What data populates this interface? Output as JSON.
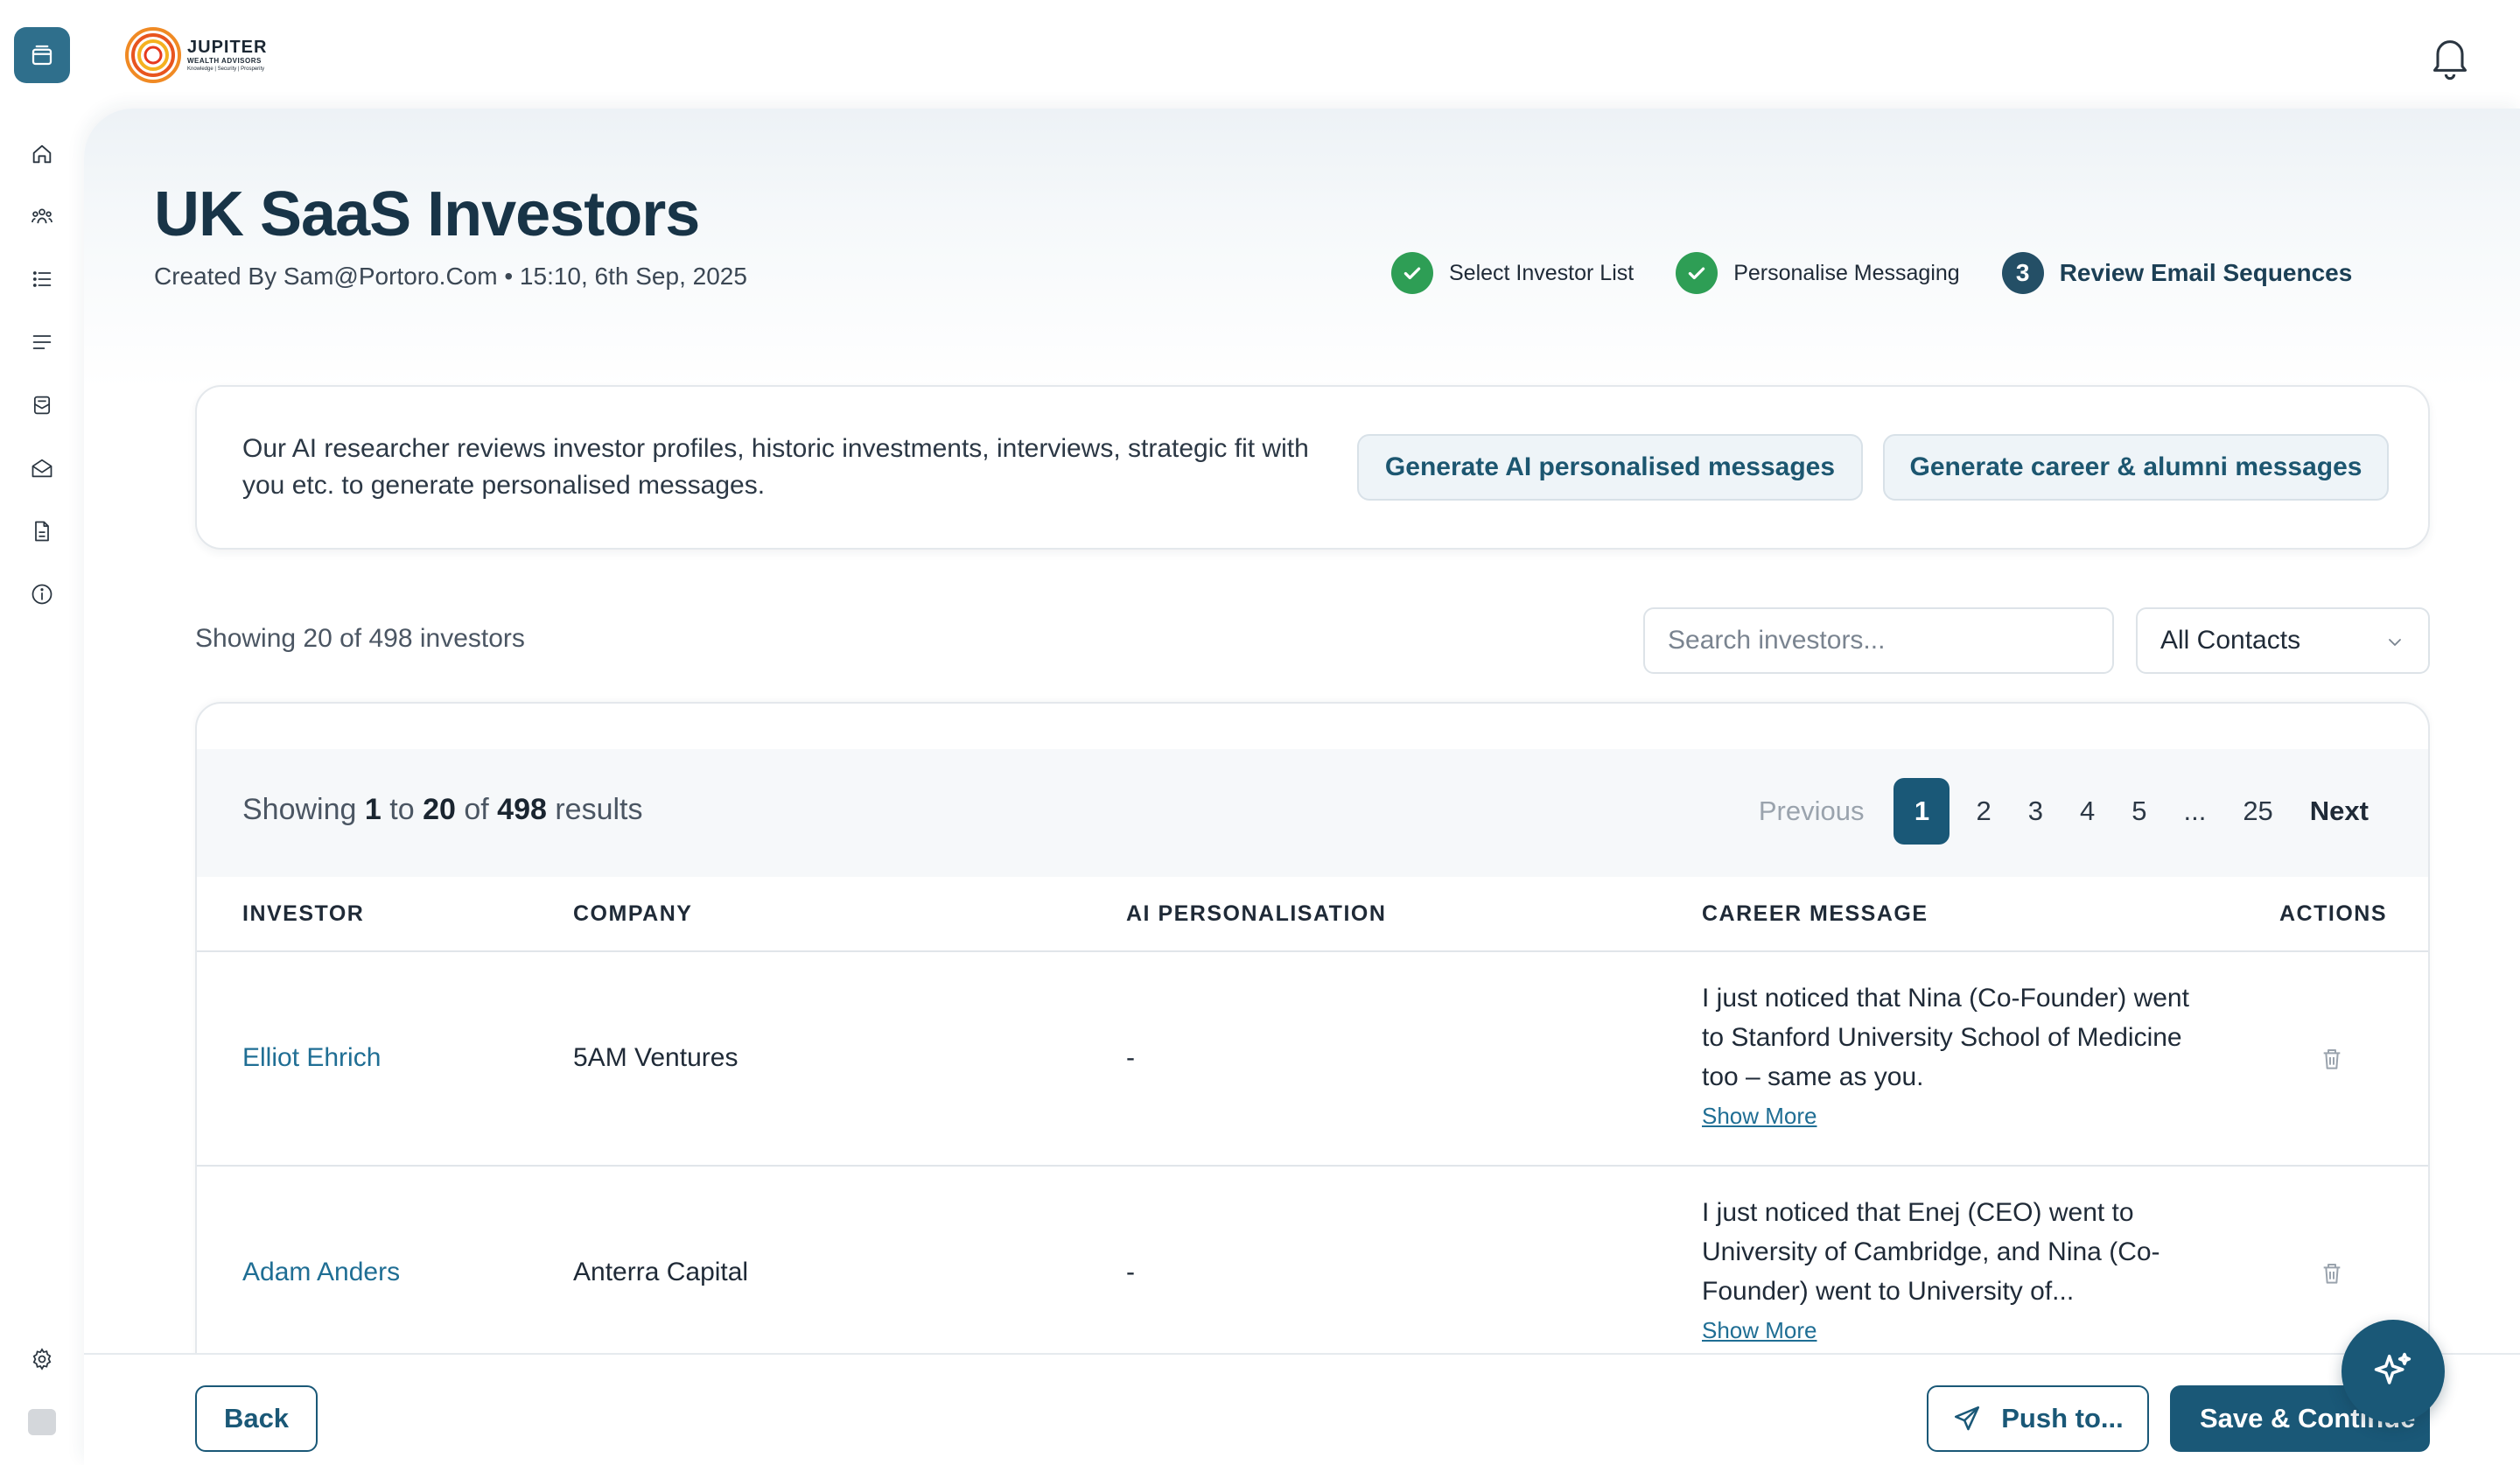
{
  "app": {
    "brand_name": "JUPITER",
    "brand_sub": "WEALTH ADVISORS",
    "brand_tagline": "Knowledge | Security | Prosperity"
  },
  "sidebar": {
    "items": [
      {
        "name": "home-icon"
      },
      {
        "name": "investors-icon"
      },
      {
        "name": "list-icon"
      },
      {
        "name": "text-lines-icon"
      },
      {
        "name": "inbox-icon"
      },
      {
        "name": "mail-open-icon"
      },
      {
        "name": "document-icon"
      },
      {
        "name": "info-icon"
      }
    ],
    "settings_icon": "gear-icon"
  },
  "page": {
    "title": "UK SaaS Investors",
    "meta": "Created By Sam@Portoro.Com • 15:10, 6th Sep, 2025"
  },
  "stepper": {
    "steps": [
      {
        "label": "Select Investor List",
        "state": "done"
      },
      {
        "label": "Personalise Messaging",
        "state": "done"
      },
      {
        "label": "Review Email Sequences",
        "state": "current",
        "number": "3"
      }
    ]
  },
  "ai_card": {
    "description": "Our AI researcher reviews investor profiles, historic investments, interviews, strategic fit with you etc. to generate personalised messages.",
    "btn_personalised": "Generate AI personalised messages",
    "btn_career": "Generate career & alumni messages"
  },
  "filters": {
    "count_text": "Showing 20 of 498 investors",
    "search_placeholder": "Search investors...",
    "select_value": "All Contacts"
  },
  "table": {
    "results": {
      "prefix": "Showing",
      "from": "1",
      "to_word": "to",
      "to": "20",
      "of_word": "of",
      "total": "498",
      "suffix": "results"
    },
    "pagination": {
      "previous": "Previous",
      "pages": [
        "1",
        "2",
        "3",
        "4",
        "5",
        "...",
        "25"
      ],
      "active": "1",
      "next": "Next"
    },
    "headers": {
      "investor": "INVESTOR",
      "company": "COMPANY",
      "ai": "AI PERSONALISATION",
      "career": "CAREER MESSAGE",
      "actions": "ACTIONS"
    },
    "rows": [
      {
        "investor": "Elliot Ehrich",
        "company": "5AM Ventures",
        "ai": "-",
        "career": "I just noticed that Nina (Co-Founder) went to Stanford University School of Medicine too – same as you.",
        "show_more": "Show More"
      },
      {
        "investor": "Adam Anders",
        "company": "Anterra Capital",
        "ai": "-",
        "career": "I just noticed that Enej (CEO) went to University of Cambridge, and Nina (Co-Founder) went to University of...",
        "show_more": "Show More"
      }
    ]
  },
  "footer": {
    "back": "Back",
    "push": "Push to...",
    "save": "Save & Continue"
  },
  "colors": {
    "primary": "#1a5877",
    "success": "#2e9e55",
    "link": "#1f6e94"
  }
}
